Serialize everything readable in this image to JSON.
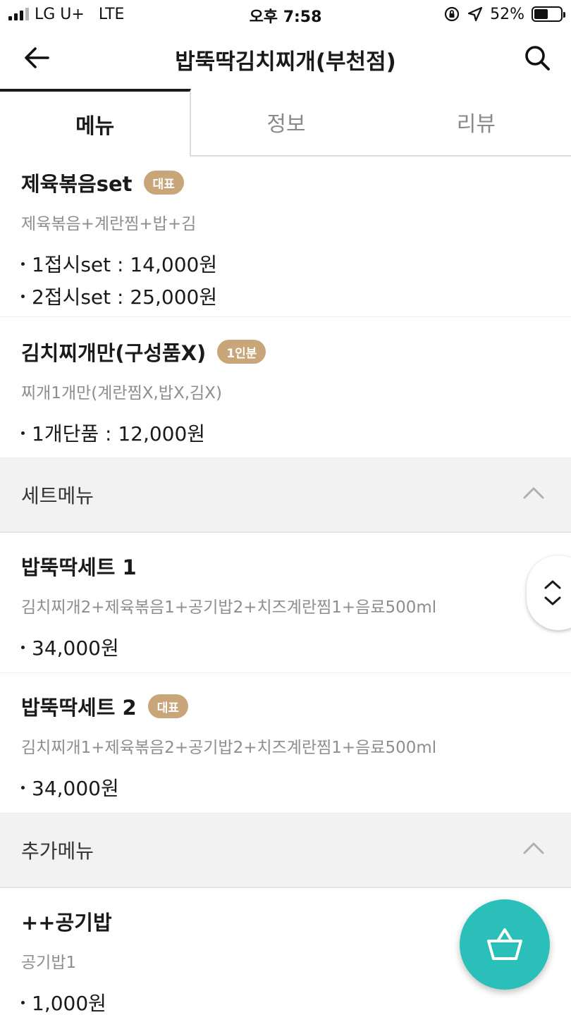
{
  "status_bar": {
    "carrier": "LG U+",
    "network": "LTE",
    "time": "오후 7:58",
    "battery": "52%",
    "battery_level": 0.52
  },
  "header": {
    "title": "밥뚝딱김치찌개(부천점)",
    "back_icon": "arrow-left-icon",
    "search_icon": "search-icon"
  },
  "tabs": [
    {
      "label": "메뉴",
      "active": true
    },
    {
      "label": "정보",
      "active": false
    },
    {
      "label": "리뷰",
      "active": false
    }
  ],
  "menu_top": [
    {
      "title": "제육볶음set",
      "badge": "대표",
      "desc": "제육볶음+계란찜+밥+김",
      "prices": [
        "1접시set : 14,000원",
        "2접시set : 25,000원"
      ]
    },
    {
      "title": "김치찌개만(구성품X)",
      "badge": "1인분",
      "desc": "찌개1개만(계란찜X,밥X,김X)",
      "prices": [
        "1개단품 : 12,000원"
      ]
    }
  ],
  "sections": [
    {
      "title": "세트메뉴",
      "items": [
        {
          "title": "밥뚝딱세트 1",
          "desc": "김치찌개2+제육볶음1+공기밥2+치즈계란찜1+음료500ml",
          "prices": [
            "34,000원"
          ]
        },
        {
          "title": "밥뚝딱세트 2",
          "badge": "대표",
          "desc": "김치찌개1+제육볶음2+공기밥2+치즈계란찜1+음료500ml",
          "prices": [
            "34,000원"
          ]
        }
      ]
    },
    {
      "title": "추가메뉴",
      "items": [
        {
          "title": "++공기밥",
          "desc": "공기밥1",
          "prices": [
            "1,000원"
          ]
        }
      ]
    }
  ],
  "colors": {
    "badge": "#c9a57a",
    "cart_button": "#2abfb8",
    "section_bg": "#f2f2f2"
  },
  "floating": {
    "scroll_icon": "chevron-up-down-icon",
    "cart_icon": "basket-icon"
  }
}
